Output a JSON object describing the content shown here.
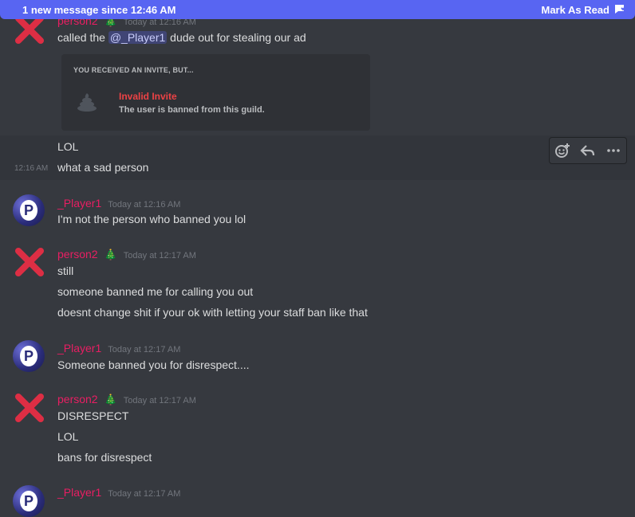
{
  "banner": {
    "text": "1 new message since 12:46 AM",
    "action": "Mark As Read"
  },
  "messages": [
    {
      "user": "person2",
      "time": "Today at 12:16 AM",
      "lines": {
        "pre": "called the ",
        "mention": "@_Player1",
        "post": " dude out for stealing our ad"
      },
      "invite": {
        "title": "YOU RECEIVED AN INVITE, BUT...",
        "status": "Invalid Invite",
        "detail": "The user is banned from this guild."
      },
      "extra": "LOL",
      "followup": {
        "time": "12:16 AM",
        "text": "what a sad person"
      }
    },
    {
      "user": "_Player1",
      "time": "Today at 12:16 AM",
      "lines": [
        "I'm not the person who banned you lol"
      ]
    },
    {
      "user": "person2",
      "time": "Today at 12:17 AM",
      "lines": [
        "still",
        "someone banned me for calling you out",
        "doesnt change shit if your ok with letting your staff ban like that"
      ]
    },
    {
      "user": "_Player1",
      "time": "Today at 12:17 AM",
      "lines": [
        "Someone banned you for disrespect...."
      ]
    },
    {
      "user": "person2",
      "time": "Today at 12:17 AM",
      "lines": [
        "DISRESPECT",
        "LOL",
        "bans for disrespect"
      ]
    },
    {
      "user": "_Player1",
      "time": "Today at 12:17 AM",
      "lines": []
    }
  ],
  "toolbar": [
    "add-reaction-icon",
    "reply-icon",
    "more-icon"
  ],
  "colors": {
    "accent": "#5865f2",
    "username": "#e91e63",
    "background": "#36393f",
    "danger": "#ed4245"
  }
}
